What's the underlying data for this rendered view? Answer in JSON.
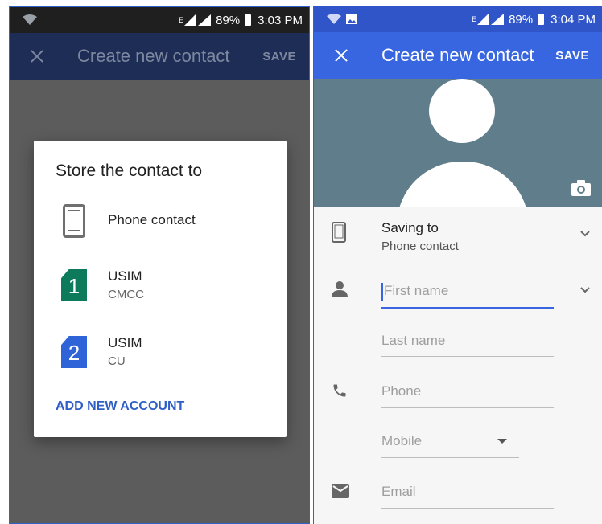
{
  "left": {
    "status": {
      "network": "E",
      "battery": "89%",
      "time": "3:03 PM"
    },
    "appbar": {
      "title": "Create new contact",
      "save": "SAVE"
    },
    "dialog": {
      "title": "Store the contact to",
      "options": [
        {
          "label": "Phone contact",
          "sub": ""
        },
        {
          "label": "USIM",
          "sub": "CMCC",
          "sim_number": "1",
          "color": "#0d7a5c"
        },
        {
          "label": "USIM",
          "sub": "CU",
          "sim_number": "2",
          "color": "#2f63d8"
        }
      ],
      "add_account": "ADD NEW ACCOUNT"
    }
  },
  "right": {
    "status": {
      "network": "E",
      "battery": "89%",
      "time": "3:04 PM"
    },
    "appbar": {
      "title": "Create new contact",
      "save": "SAVE"
    },
    "saving_to": {
      "label": "Saving to",
      "value": "Phone contact"
    },
    "fields": {
      "first_name": "First name",
      "last_name": "Last name",
      "phone": "Phone",
      "phone_type": "Mobile",
      "email": "Email"
    }
  },
  "colors": {
    "accent": "#3766e0",
    "left_appbar": "#1d2d55",
    "hero": "#607d8b"
  }
}
